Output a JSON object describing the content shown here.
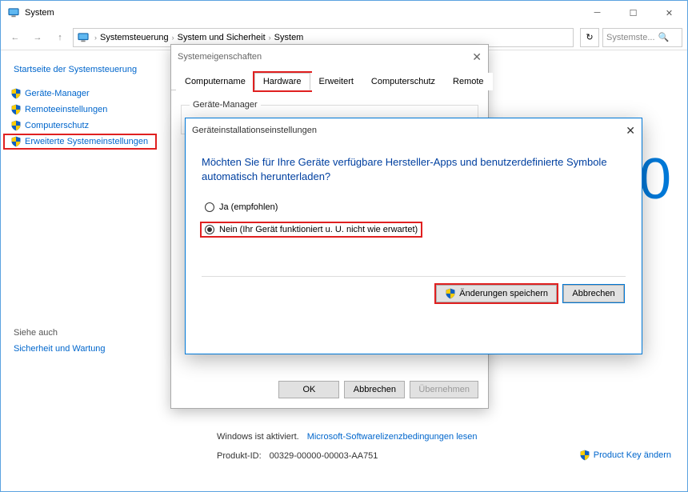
{
  "titlebar": {
    "title": "System"
  },
  "toolbar": {
    "breadcrumb": [
      "Systemsteuerung",
      "System und Sicherheit",
      "System"
    ],
    "search_placeholder": "Systemste..."
  },
  "sidebar": {
    "home": "Startseite der Systemsteuerung",
    "links": [
      {
        "label": "Geräte-Manager"
      },
      {
        "label": "Remoteeinstellungen"
      },
      {
        "label": "Computerschutz"
      },
      {
        "label": "Erweiterte Systemeinstellungen",
        "highlighted": true
      }
    ],
    "see_also": "Siehe auch",
    "see_also_link": "Sicherheit und Wartung"
  },
  "content": {
    "big_version": "0",
    "activation_label": "Windows ist aktiviert.",
    "activation_link": "Microsoft-Softwarelizenzbedingungen lesen",
    "product_id_label": "Produkt-ID:",
    "product_id_value": "00329-00000-00003-AA751",
    "product_key_link": "Product Key ändern"
  },
  "sysprops": {
    "title": "Systemeigenschaften",
    "tabs": [
      "Computername",
      "Hardware",
      "Erweitert",
      "Computerschutz",
      "Remote"
    ],
    "active_tab": 1,
    "group_label": "Geräte-Manager",
    "ok": "OK",
    "cancel": "Abbrechen",
    "apply": "Übernehmen"
  },
  "devdlg": {
    "title": "Geräteinstallationseinstellungen",
    "question": "Möchten Sie für Ihre Geräte verfügbare Hersteller-Apps und benutzerdefinierte Symbole automatisch herunterladen?",
    "opt_yes": "Ja (empfohlen)",
    "opt_no": "Nein (Ihr Gerät funktioniert u. U. nicht wie erwartet)",
    "selected": "no",
    "save": "Änderungen speichern",
    "cancel": "Abbrechen"
  }
}
